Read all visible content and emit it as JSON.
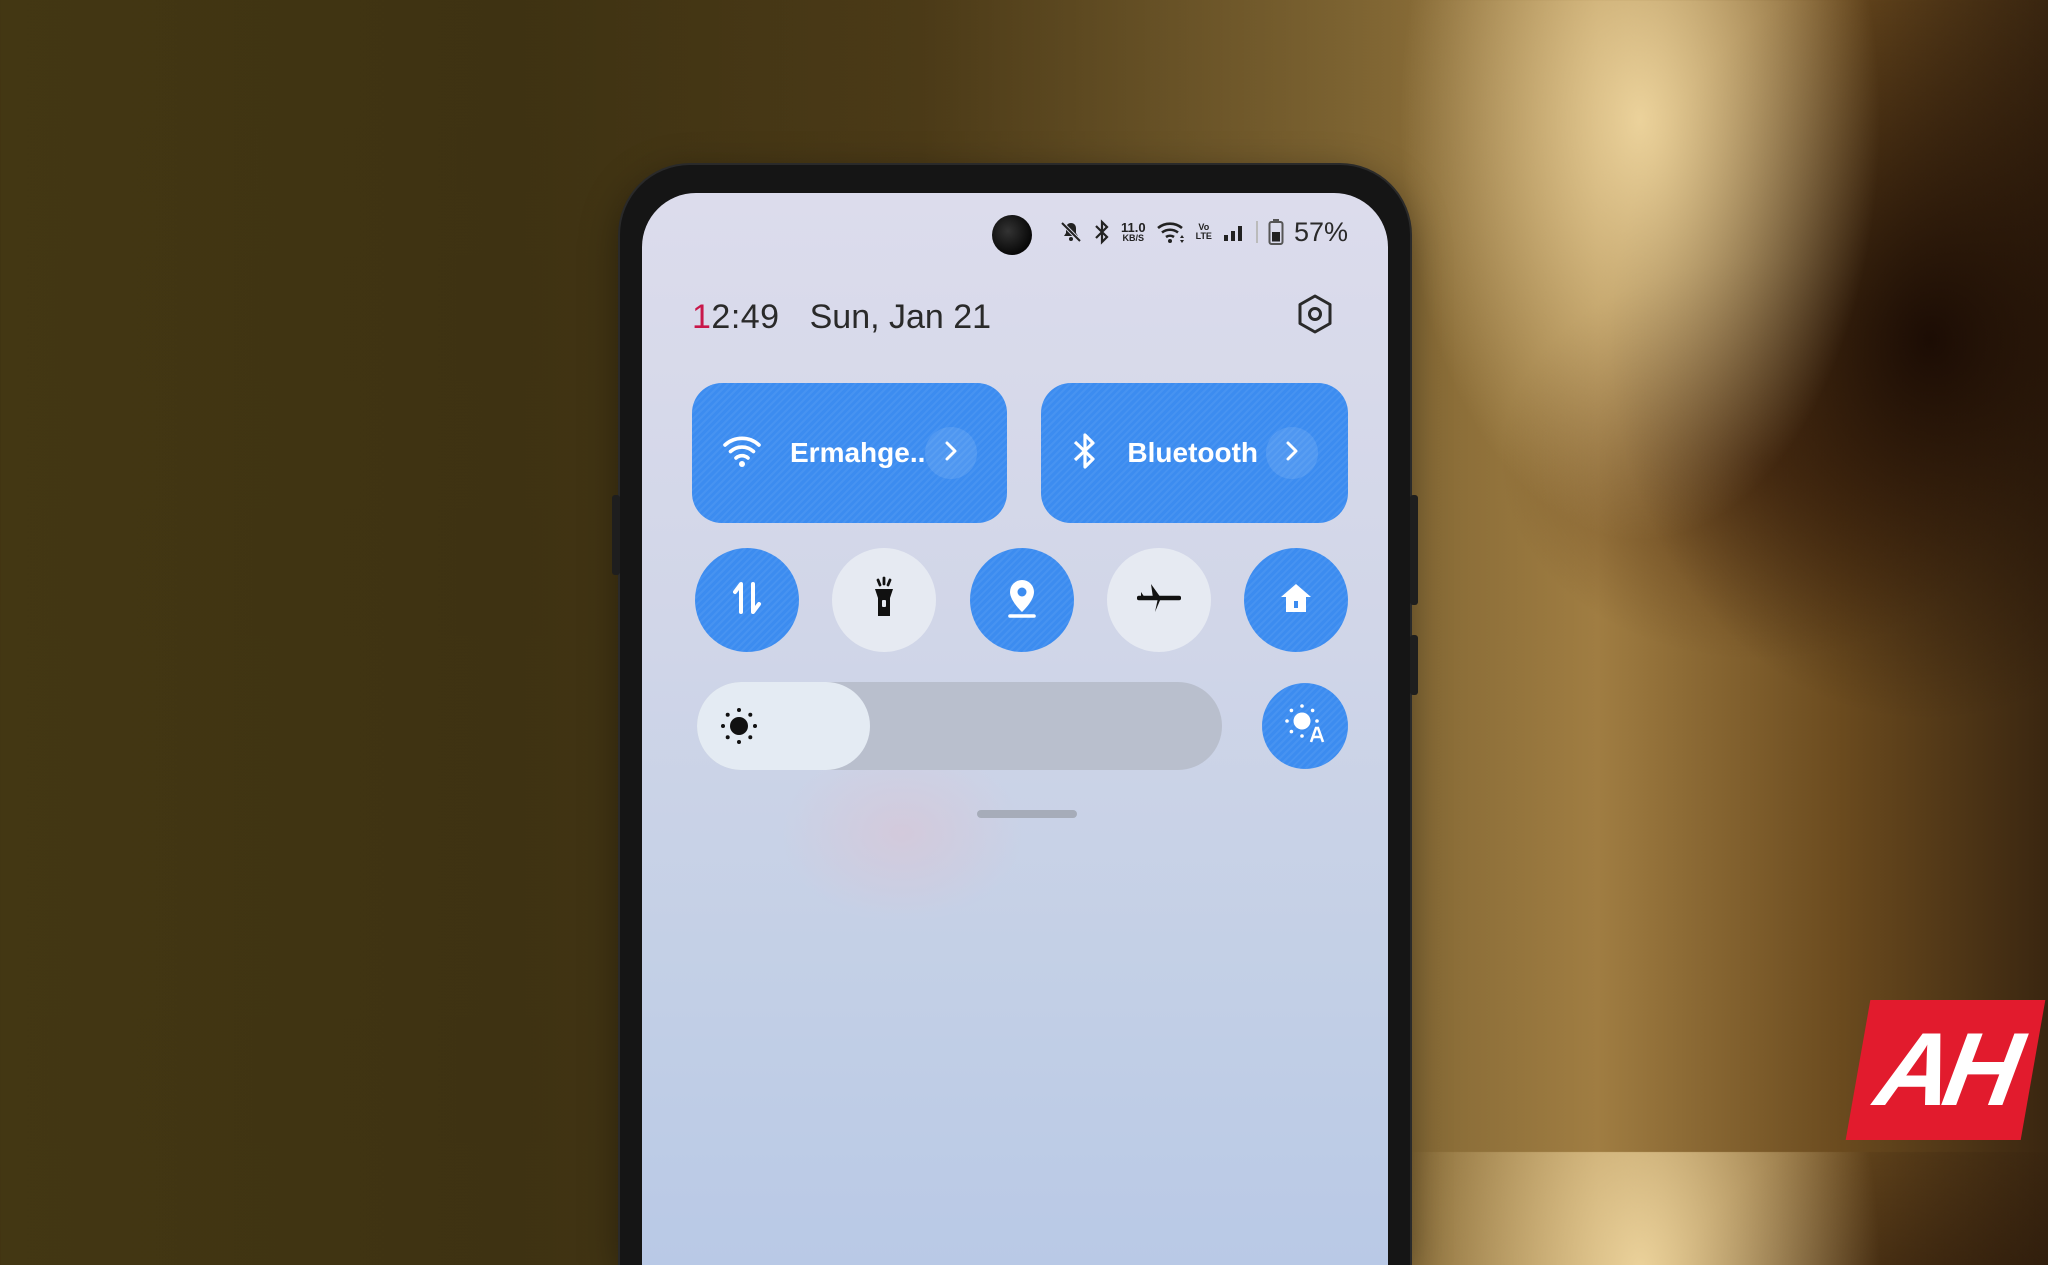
{
  "status_bar": {
    "icons": [
      "mute-icon",
      "bluetooth-icon",
      "wifi-icon",
      "volte-icon",
      "signal-icon",
      "battery-icon"
    ],
    "net_speed_value": "11.0",
    "net_speed_unit": "KB/S",
    "volte_top": "Vo",
    "volte_bottom": "LTE",
    "battery_percent": "57%"
  },
  "header": {
    "clock_first_digit": "1",
    "clock_rest": "2:49",
    "date": "Sun, Jan 21",
    "settings_icon": "settings-hexagon-icon"
  },
  "big_tiles": [
    {
      "label": "Ermahge..",
      "icon": "wifi-icon",
      "state": "on"
    },
    {
      "label": "Bluetooth",
      "icon": "bluetooth-icon",
      "state": "on"
    }
  ],
  "toggles": [
    {
      "name": "mobile-data",
      "icon": "data-arrows-icon",
      "state": "on"
    },
    {
      "name": "flashlight",
      "icon": "flashlight-icon",
      "state": "off"
    },
    {
      "name": "location",
      "icon": "location-pin-icon",
      "state": "on"
    },
    {
      "name": "airplane-mode",
      "icon": "airplane-icon",
      "state": "off"
    },
    {
      "name": "home",
      "icon": "home-icon",
      "state": "on"
    }
  ],
  "brightness": {
    "level_percent": 33,
    "icon": "brightness-sun-icon",
    "auto_icon": "auto-brightness-icon",
    "auto_state": "on"
  },
  "colors": {
    "accent_blue": "#3c8cf0",
    "clock_accent": "#c8174a",
    "watermark_red": "#e21b2d"
  },
  "watermark": {
    "text": "AH"
  }
}
